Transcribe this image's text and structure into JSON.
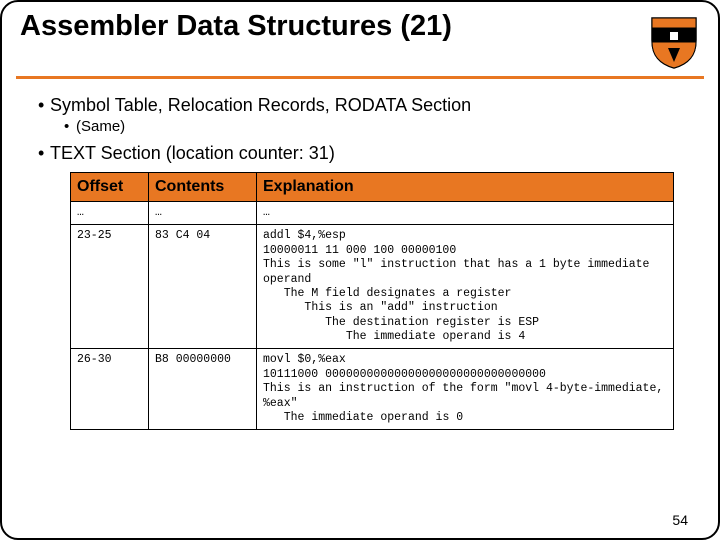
{
  "title": "Assembler Data Structures (21)",
  "bullets": {
    "b1a": "Symbol Table, Relocation Records, RODATA Section",
    "b2a": "(Same)",
    "b1b": "TEXT Section (location counter: 31)"
  },
  "table": {
    "headers": {
      "h1": "Offset",
      "h2": "Contents",
      "h3": "Explanation"
    },
    "rows": [
      {
        "offset": "…",
        "contents": "…",
        "explanation": "…"
      },
      {
        "offset": "23-25",
        "contents": "83 C4 04",
        "explanation": "addl $4,%esp\n10000011 11 000 100 00000100\nThis is some \"l\" instruction that has a 1 byte immediate operand\n   The M field designates a register\n      This is an \"add\" instruction\n         The destination register is ESP\n            The immediate operand is 4"
      },
      {
        "offset": "26-30",
        "contents": "B8 00000000",
        "explanation": "movl $0,%eax\n10111000 00000000000000000000000000000000\nThis is an instruction of the form \"movl 4-byte-immediate, %eax\"\n   The immediate operand is 0"
      }
    ]
  },
  "pagenum": "54"
}
